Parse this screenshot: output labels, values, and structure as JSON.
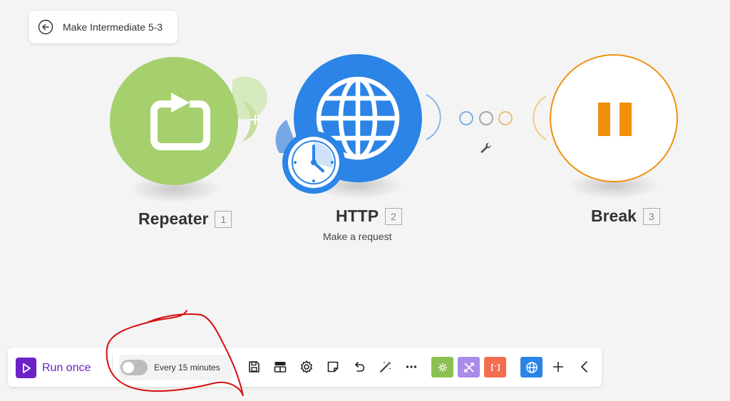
{
  "scenario": {
    "title": "Make Intermediate 5-3"
  },
  "modules": [
    {
      "name": "Repeater",
      "number": "1",
      "icon": "repeat-icon",
      "color": "#a5d06d"
    },
    {
      "name": "HTTP",
      "number": "2",
      "subtitle": "Make a request",
      "icon": "globe-icon",
      "color": "#2b84e6",
      "badge_icon": "clock-icon"
    },
    {
      "name": "Break",
      "number": "3",
      "icon": "pause-icon",
      "color": "#f0900c"
    }
  ],
  "connector": {
    "filter_icon": "wrench-icon",
    "add_icon": "plus-icon"
  },
  "toolbar": {
    "run_once_label": "Run once",
    "schedule_label": "Every 15 minutes",
    "schedule_enabled": false,
    "icons": [
      "save-icon",
      "auto-align-icon",
      "settings-icon",
      "notes-icon",
      "undo-icon",
      "magic-wand-icon",
      "more-icon"
    ],
    "app_buttons": [
      {
        "icon": "tools-icon",
        "color": "#8cc152"
      },
      {
        "icon": "flow-control-icon",
        "color": "#a98be8"
      },
      {
        "icon": "text-parser-icon",
        "color": "#f36d4f"
      },
      {
        "icon": "http-icon",
        "color": "#2b84e6"
      }
    ],
    "add_icon": "plus-icon",
    "collapse_icon": "chevron-left-icon"
  },
  "colors": {
    "accent": "#6d22c8",
    "annotation": "#d40f0f"
  }
}
